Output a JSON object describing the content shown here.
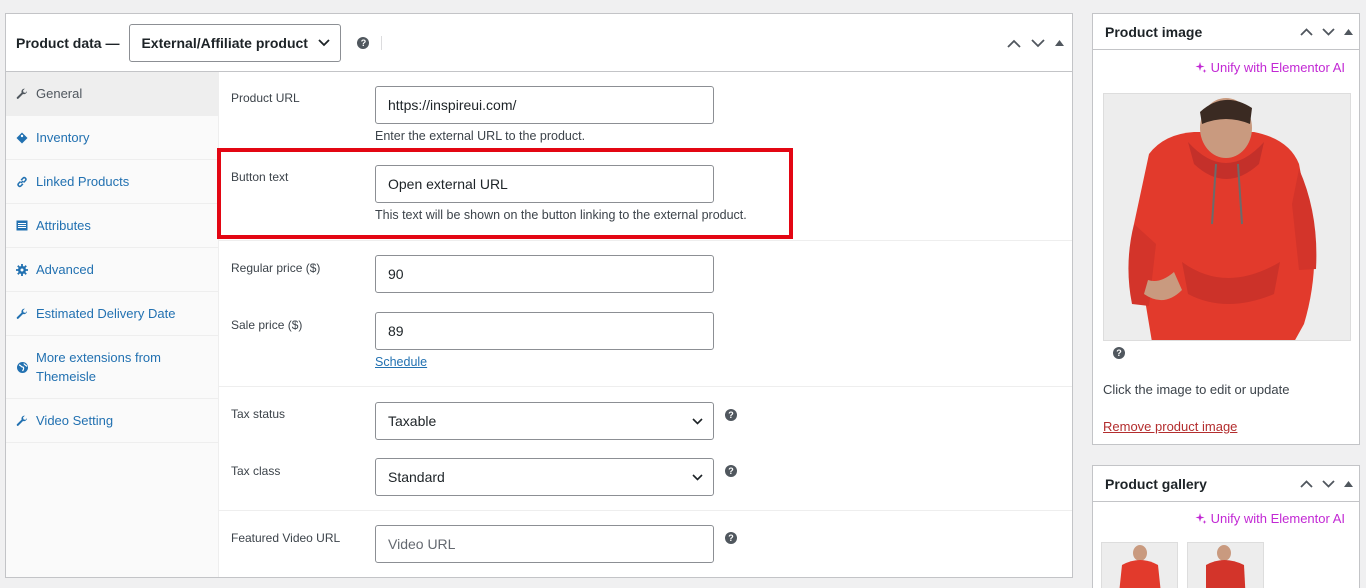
{
  "product_data": {
    "title": "Product data —",
    "type_select": "External/Affiliate product",
    "help": "?"
  },
  "tabs": [
    {
      "label": "General",
      "icon": "wrench-icon",
      "active": true
    },
    {
      "label": "Inventory",
      "icon": "tag-icon"
    },
    {
      "label": "Linked Products",
      "icon": "link-icon"
    },
    {
      "label": "Attributes",
      "icon": "table-icon"
    },
    {
      "label": "Advanced",
      "icon": "gear-icon"
    },
    {
      "label": "Estimated Delivery Date",
      "icon": "wrench-icon"
    },
    {
      "label": "More extensions from Themeisle",
      "icon": "globe-icon"
    },
    {
      "label": "Video Setting",
      "icon": "wrench-icon"
    }
  ],
  "fields": {
    "product_url": {
      "label": "Product URL",
      "value": "https://inspireui.com/",
      "desc": "Enter the external URL to the product."
    },
    "button_text": {
      "label": "Button text",
      "value": "Open external URL",
      "desc": "This text will be shown on the button linking to the external product."
    },
    "regular_price": {
      "label": "Regular price ($)",
      "value": "90"
    },
    "sale_price": {
      "label": "Sale price ($)",
      "value": "89",
      "schedule": "Schedule"
    },
    "tax_status": {
      "label": "Tax status",
      "value": "Taxable"
    },
    "tax_class": {
      "label": "Tax class",
      "value": "Standard"
    },
    "featured_video": {
      "label": "Featured Video URL",
      "placeholder": "Video URL"
    }
  },
  "product_image": {
    "title": "Product image",
    "unify": "Unify with Elementor AI",
    "help": "?",
    "hint": "Click the image to edit or update",
    "remove": "Remove product image"
  },
  "product_gallery": {
    "title": "Product gallery",
    "unify": "Unify with Elementor AI"
  },
  "colors": {
    "link": "#2271b1",
    "accent_ai": "#c228d4",
    "highlight": "#e30613",
    "remove": "#b32d2e",
    "hoodie": "#e23a2c"
  }
}
